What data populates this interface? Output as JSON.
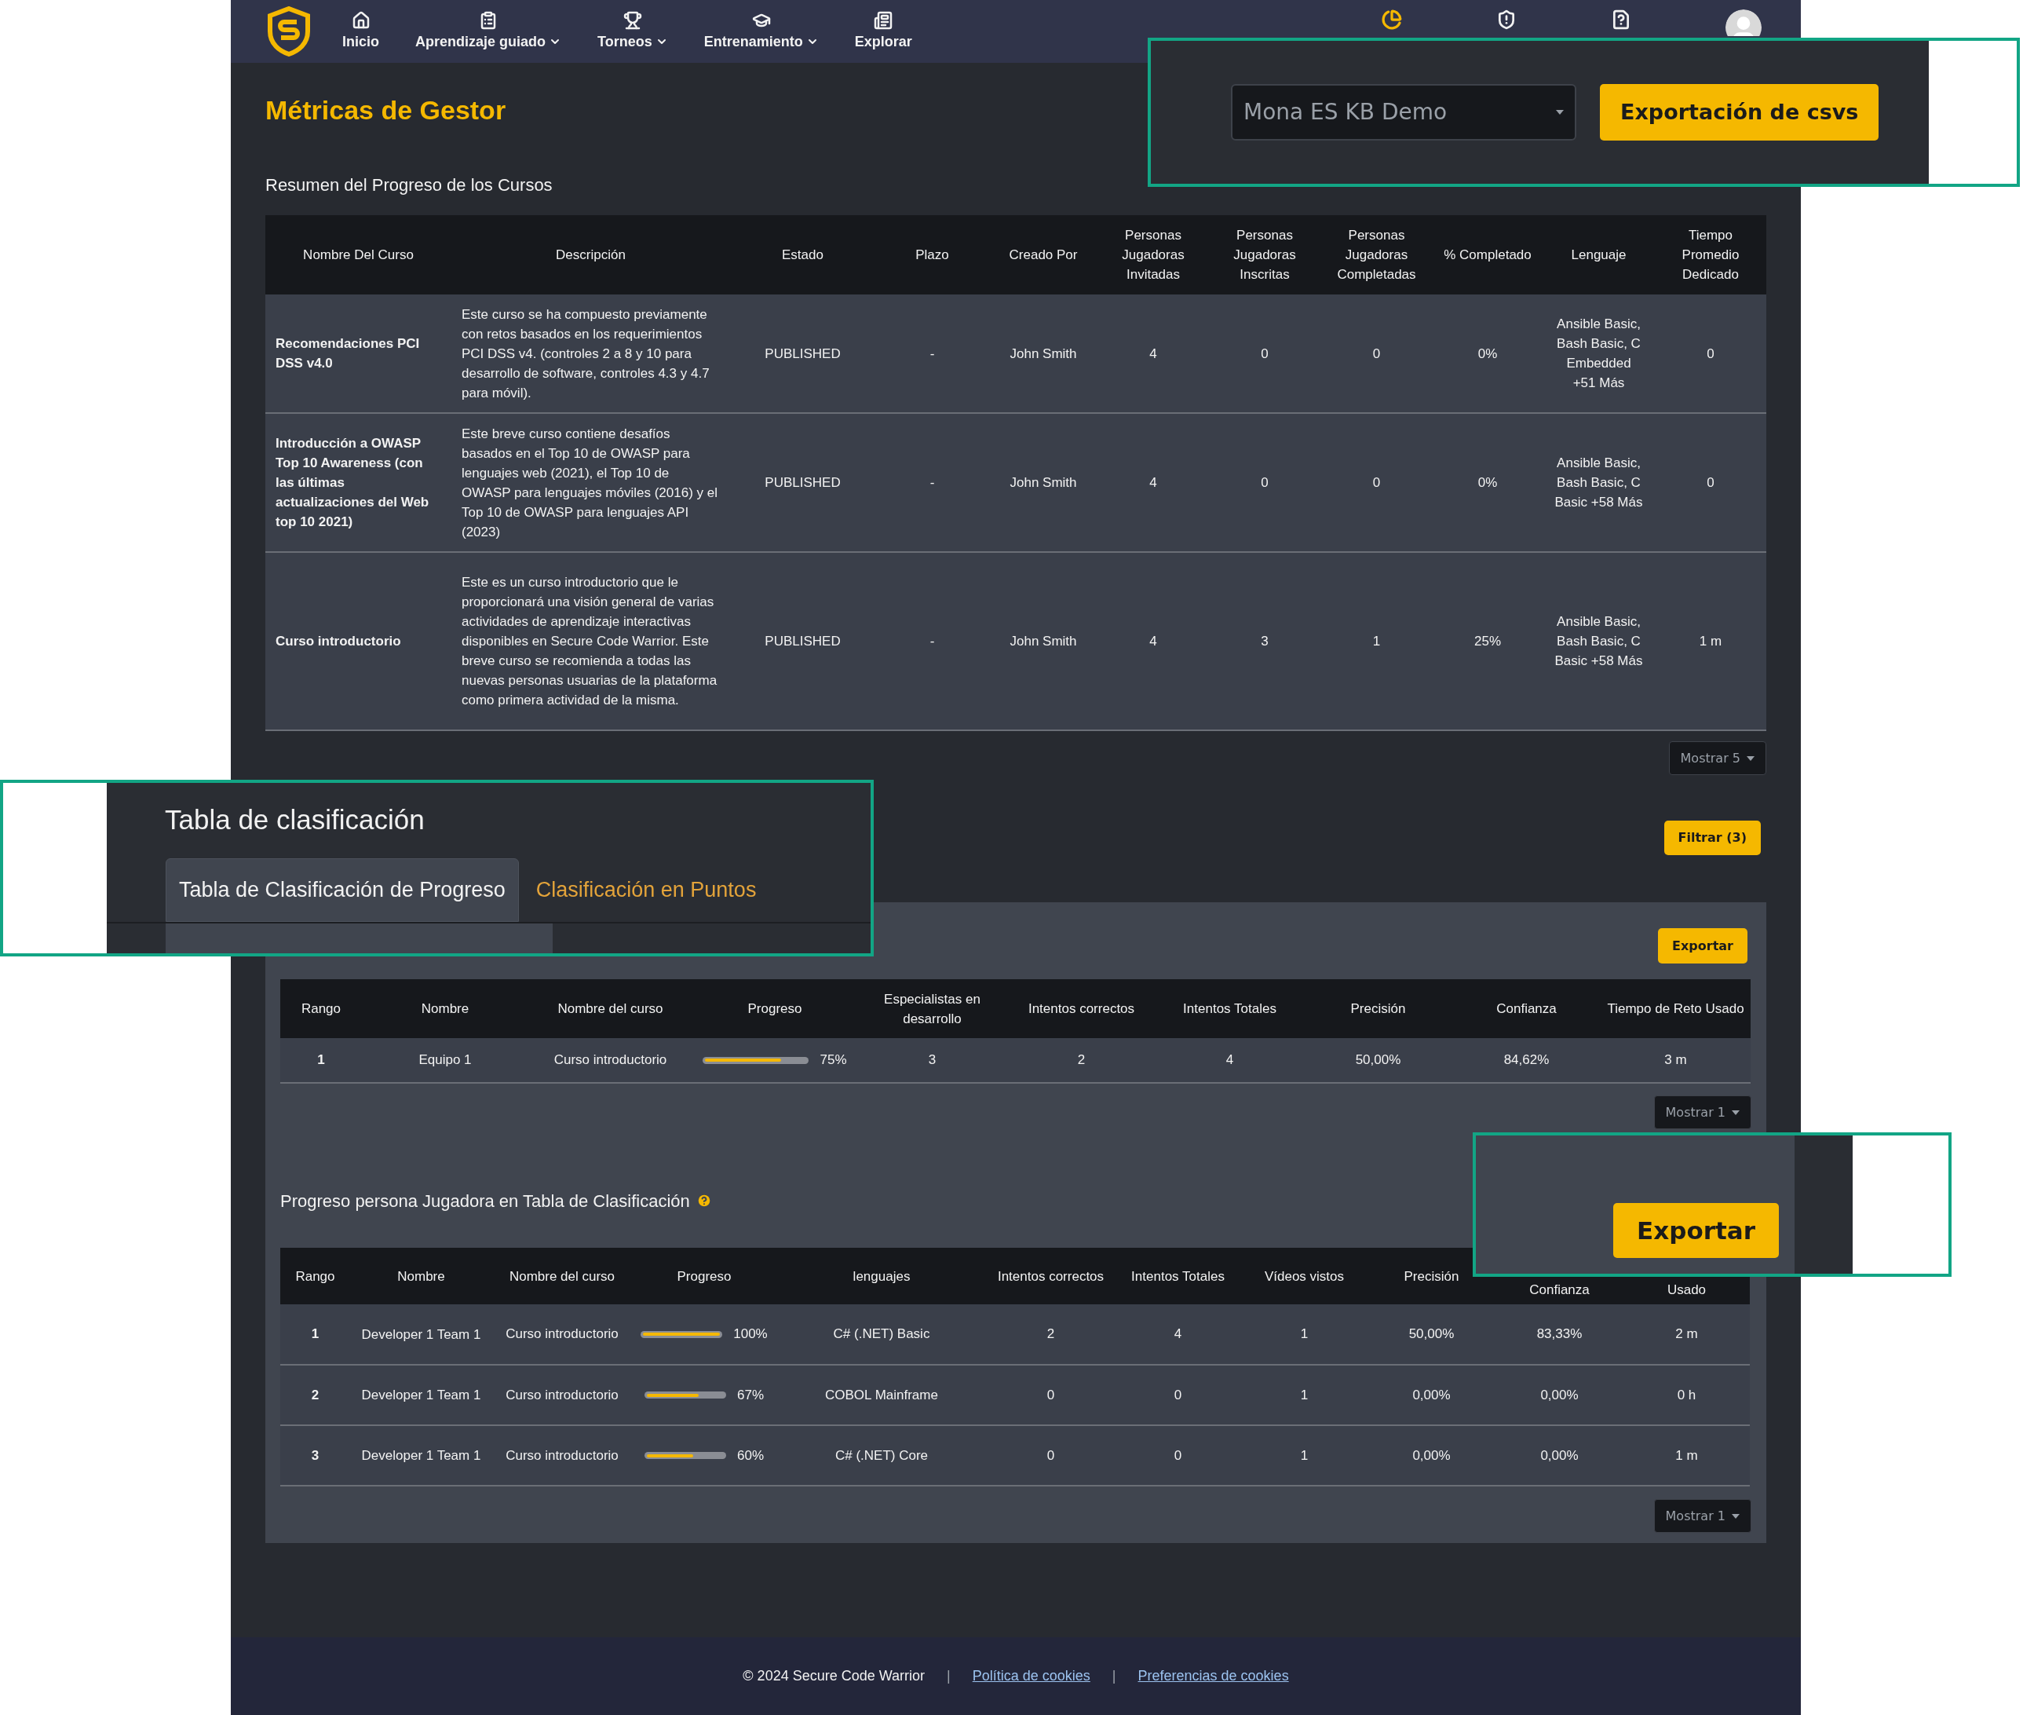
{
  "nav": {
    "items": [
      {
        "label": "Inicio",
        "dropdown": false
      },
      {
        "label": "Aprendizaje guiado",
        "dropdown": true
      },
      {
        "label": "Torneos",
        "dropdown": true
      },
      {
        "label": "Entrenamiento",
        "dropdown": true
      },
      {
        "label": "Explorar",
        "dropdown": false
      }
    ]
  },
  "page": {
    "title": "Métricas de Gestor"
  },
  "course_summary": {
    "title": "Resumen del Progreso de los Cursos",
    "table": {
      "columns": [
        "Nombre Del Curso",
        "Descripción",
        "Estado",
        "Plazo",
        "Creado Por",
        "Personas Jugadoras Invitadas",
        "Personas Jugadoras Inscritas",
        "Personas Jugadoras Completadas",
        "% Completado",
        "Lenguaje",
        "Tiempo Promedio Dedicado"
      ],
      "rows": [
        {
          "cells": [
            "Recomendaciones PCI DSS v4.0",
            "Este curso se ha compuesto previamente con retos basados en los requerimientos PCI DSS v4. (controles 2 a 8 y 10 para desarrollo de software, controles 4.3 y 4.7 para móvil).",
            "PUBLISHED",
            "-",
            "John Smith",
            "4",
            "0",
            "0",
            "0%",
            "Ansible Basic, Bash Basic, C Embedded +51 Más",
            "0"
          ]
        },
        {
          "cells": [
            "Introducción a OWASP Top 10 Awareness (con las últimas actualizaciones del Web top 10 2021)",
            "Este breve curso contiene desafíos basados en el Top 10 de OWASP para lenguajes web (2021), el Top 10 de OWASP para lenguajes móviles (2016) y el Top 10 de OWASP para lenguajes API (2023)",
            "PUBLISHED",
            "-",
            "John Smith",
            "4",
            "0",
            "0",
            "0%",
            "Ansible Basic, Bash Basic, C Basic +58 Más",
            "0"
          ]
        },
        {
          "cells": [
            "Curso introductorio",
            "Este es un curso introductorio que le proporcionará una visión general de varias actividades de aprendizaje interactivas disponibles en Secure Code Warrior. Este breve curso se recomienda a todas las nuevas personas usuarias de la plataforma como primera actividad de la misma.",
            "PUBLISHED",
            "-",
            "John Smith",
            "4",
            "3",
            "1",
            "25%",
            "Ansible Basic, Bash Basic, C Basic +58 Más",
            "1 m"
          ]
        }
      ]
    },
    "page_size": "Mostrar 5"
  },
  "filter_button": "Filtrar (3)",
  "leaderboard": {
    "export_button": "Exportar",
    "table": {
      "columns": [
        "Rango",
        "Nombre",
        "Nombre del curso",
        "Progreso",
        "Especialistas en desarrollo",
        "Intentos correctos",
        "Intentos Totales",
        "Precisión",
        "Confianza",
        "Tiempo de Reto Usado"
      ],
      "rows": [
        {
          "rank": "1",
          "name": "Equipo 1",
          "course": "Curso introductorio",
          "progress": {
            "level": 0.75,
            "reading": "75%"
          },
          "rest": [
            "3",
            "2",
            "4",
            "50,00%",
            "84,62%",
            "3 m"
          ]
        }
      ]
    },
    "page_size": "Mostrar 1"
  },
  "player_progress": {
    "title": "Progreso persona Jugadora en Tabla de Clasificación",
    "table": {
      "columns": [
        "Rango",
        "Nombre",
        "Nombre del curso",
        "Progreso",
        "lenguajes",
        "Intentos correctos",
        "Intentos Totales",
        "Vídeos vistos",
        "Precisión",
        "Confianza",
        "Usado"
      ],
      "rows": [
        {
          "rank": "1",
          "name": "Developer 1 Team 1",
          "course": "Curso introductorio",
          "progress": {
            "level": 1,
            "reading": "100%"
          },
          "rest": [
            "C# (.NET) Basic",
            "2",
            "4",
            "1",
            "50,00%",
            "83,33%",
            "2 m"
          ]
        },
        {
          "rank": "2",
          "name": "Developer 1 Team 1",
          "course": "Curso introductorio",
          "progress": {
            "level": 0.67,
            "reading": "67%"
          },
          "rest": [
            "COBOL Mainframe",
            "0",
            "0",
            "1",
            "0,00%",
            "0,00%",
            "0 h"
          ]
        },
        {
          "rank": "3",
          "name": "Developer 1 Team 1",
          "course": "Curso introductorio",
          "progress": {
            "level": 0.6,
            "reading": "60%"
          },
          "rest": [
            "C# (.NET) Core",
            "0",
            "0",
            "1",
            "0,00%",
            "0,00%",
            "1 m"
          ]
        }
      ]
    },
    "page_size": "Mostrar 1"
  },
  "footer": {
    "copyright": "© 2024 Secure Code Warrior",
    "separators": [
      "|",
      "|"
    ],
    "links": [
      "Política de cookies",
      "Preferencias de cookies"
    ]
  },
  "callouts": [
    {
      "kind": "org_export",
      "org_select": "Mona ES KB Demo",
      "button": "Exportación de csvs"
    },
    {
      "kind": "tabs",
      "title": "Tabla de clasificación",
      "tabs": [
        {
          "label": "Tabla de Clasificación de Progreso",
          "selected": true
        },
        {
          "label": "Clasificación en Puntos",
          "selected": false
        }
      ]
    },
    {
      "kind": "export",
      "button": "Exportar"
    }
  ]
}
